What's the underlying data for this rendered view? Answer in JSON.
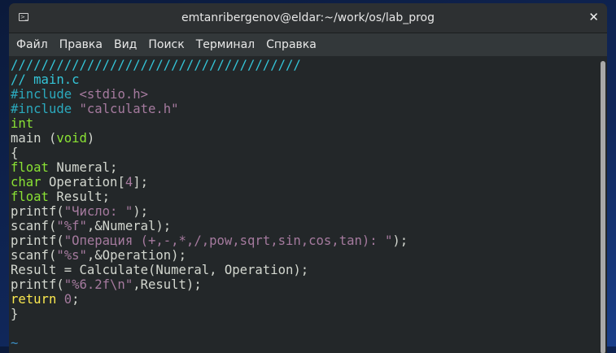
{
  "window": {
    "title": "emtanribergenov@eldar:~/work/os/lab_prog"
  },
  "menu": [
    "Файл",
    "Правка",
    "Вид",
    "Поиск",
    "Терминал",
    "Справка"
  ],
  "colors": {
    "comment": "#34c5d8",
    "preprocessor": "#2ba9bd",
    "string": "#a57a9e",
    "type": "#8ae234",
    "keyword": "#fce94f",
    "text": "#d3d7cf",
    "background": "#232729"
  },
  "code": [
    [
      [
        "//////////////////////////////////////",
        "cm"
      ]
    ],
    [
      [
        "// main.c",
        "cm"
      ]
    ],
    [
      [
        "#include ",
        "pp"
      ],
      [
        "<stdio.h>",
        "st"
      ]
    ],
    [
      [
        "#include ",
        "pp"
      ],
      [
        "\"calculate.h\"",
        "st"
      ]
    ],
    [
      [
        "int",
        "ty"
      ]
    ],
    [
      [
        "main (",
        ""
      ],
      [
        "void",
        "ty"
      ],
      [
        ")",
        ""
      ]
    ],
    [
      [
        "{",
        ""
      ]
    ],
    [
      [
        "float",
        "ty"
      ],
      [
        " Numeral;",
        ""
      ]
    ],
    [
      [
        "char",
        "ty"
      ],
      [
        " Operation[",
        ""
      ],
      [
        "4",
        "nu"
      ],
      [
        "];",
        ""
      ]
    ],
    [
      [
        "float",
        "ty"
      ],
      [
        " Result;",
        ""
      ]
    ],
    [
      [
        "printf(",
        ""
      ],
      [
        "\"Число: \"",
        "st"
      ],
      [
        ");",
        ""
      ]
    ],
    [
      [
        "scanf(",
        ""
      ],
      [
        "\"%f\"",
        "st"
      ],
      [
        ",&Numeral);",
        ""
      ]
    ],
    [
      [
        "printf(",
        ""
      ],
      [
        "\"Операция (+,-,*,/,pow,sqrt,sin,cos,tan): \"",
        "st"
      ],
      [
        ");",
        ""
      ]
    ],
    [
      [
        "scanf(",
        ""
      ],
      [
        "\"%s\"",
        "st"
      ],
      [
        ",&Operation);",
        ""
      ]
    ],
    [
      [
        "Result = Calculate(Numeral, Operation);",
        ""
      ]
    ],
    [
      [
        "printf(",
        ""
      ],
      [
        "\"%6.2f\\n\"",
        "st"
      ],
      [
        ",Result);",
        ""
      ]
    ],
    [
      [
        "return",
        "kw"
      ],
      [
        " ",
        ""
      ],
      [
        "0",
        "nu"
      ],
      [
        ";",
        ""
      ]
    ],
    [
      [
        "}",
        ""
      ]
    ],
    [
      [
        "",
        ""
      ]
    ],
    [
      [
        "~",
        "ti"
      ]
    ]
  ]
}
